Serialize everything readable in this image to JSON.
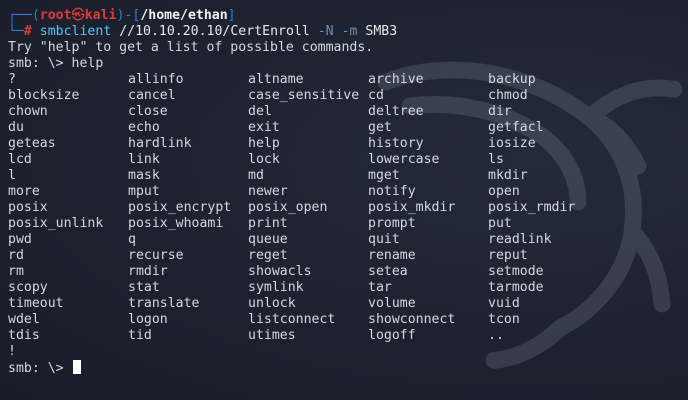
{
  "prompt": {
    "frame_top": "┌──(",
    "user": "root",
    "skull": "㉿",
    "host": "kali",
    "frame_mid": ")-[",
    "path": "/home/ethan",
    "frame_end": "]",
    "frame_bottom": "└─",
    "hash": "#"
  },
  "command": {
    "program": "smbclient",
    "target": "//10.10.20.10/CertEnroll",
    "flag_n": "-N",
    "flag_m": "-m",
    "proto": "SMB3"
  },
  "output": {
    "hint": "Try \"help\" to get a list of possible commands.",
    "smb_prompt_help": "smb: \\> help",
    "commands": [
      [
        "?",
        "allinfo",
        "altname",
        "archive",
        "backup"
      ],
      [
        "blocksize",
        "cancel",
        "case_sensitive",
        "cd",
        "chmod"
      ],
      [
        "chown",
        "close",
        "del",
        "deltree",
        "dir"
      ],
      [
        "du",
        "echo",
        "exit",
        "get",
        "getfacl"
      ],
      [
        "geteas",
        "hardlink",
        "help",
        "history",
        "iosize"
      ],
      [
        "lcd",
        "link",
        "lock",
        "lowercase",
        "ls"
      ],
      [
        "l",
        "mask",
        "md",
        "mget",
        "mkdir"
      ],
      [
        "more",
        "mput",
        "newer",
        "notify",
        "open"
      ],
      [
        "posix",
        "posix_encrypt",
        "posix_open",
        "posix_mkdir",
        "posix_rmdir"
      ],
      [
        "posix_unlink",
        "posix_whoami",
        "print",
        "prompt",
        "put"
      ],
      [
        "pwd",
        "q",
        "queue",
        "quit",
        "readlink"
      ],
      [
        "rd",
        "recurse",
        "reget",
        "rename",
        "reput"
      ],
      [
        "rm",
        "rmdir",
        "showacls",
        "setea",
        "setmode"
      ],
      [
        "scopy",
        "stat",
        "symlink",
        "tar",
        "tarmode"
      ],
      [
        "timeout",
        "translate",
        "unlock",
        "volume",
        "vuid"
      ],
      [
        "wdel",
        "logon",
        "listconnect",
        "showconnect",
        "tcon"
      ],
      [
        "tdis",
        "tid",
        "utimes",
        "logoff",
        ".."
      ],
      [
        "!",
        "",
        "",
        "",
        ""
      ]
    ],
    "smb_prompt_final": "smb: \\> "
  },
  "colors": {
    "background": "#1e2330",
    "prompt_frame": "#2f7bd6",
    "prompt_user_host": "#e03b3b",
    "command": "#55c3ff",
    "text": "#d6d8dc"
  },
  "icons": {
    "background_logo": "kali-dragon-icon",
    "cursor": "block-cursor-icon"
  }
}
